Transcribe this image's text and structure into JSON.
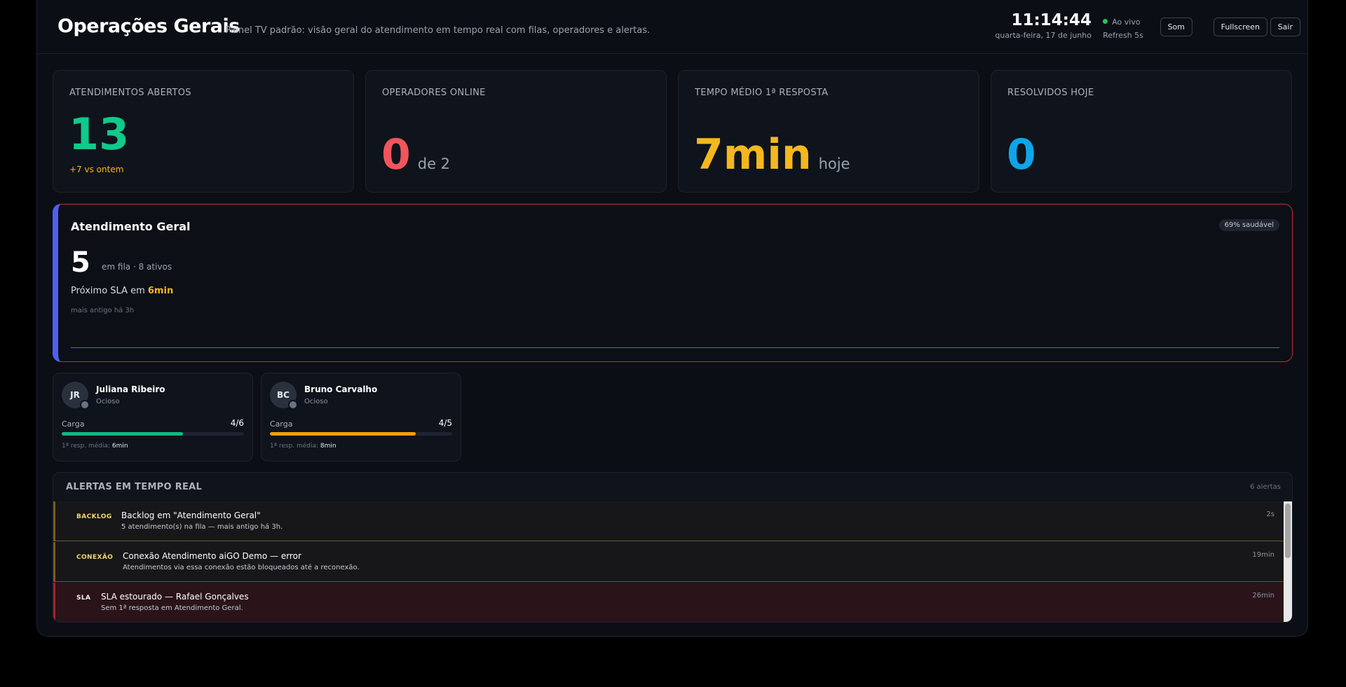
{
  "header": {
    "title": "Operações Gerais",
    "subtitle": "Painel TV padrão: visão geral do atendimento em tempo real com filas, operadores e alertas.",
    "time": "11:14:44",
    "date": "quarta-feira, 17 de junho",
    "live_label": "Ao vivo",
    "refresh_label": "Refresh 5s",
    "buttons": {
      "sound": "Som",
      "fullscreen": "Fullscreen",
      "exit": "Sair"
    }
  },
  "kpis": [
    {
      "label": "ATENDIMENTOS ABERTOS",
      "value": "13",
      "suffix": "",
      "sub": "+7 vs ontem",
      "color": "#10c98a"
    },
    {
      "label": "OPERADORES ONLINE",
      "value": "0",
      "suffix": "de 2",
      "sub": "",
      "color": "#f2545b"
    },
    {
      "label": "TEMPO MÉDIO 1ª RESPOSTA",
      "value": "7min",
      "suffix": "hoje",
      "sub": "",
      "color": "#f5b71f"
    },
    {
      "label": "RESOLVIDOS HOJE",
      "value": "0",
      "suffix": "",
      "sub": "",
      "color": "#0ea5e9"
    }
  ],
  "queue": {
    "name": "Atendimento Geral",
    "health": "69% saudável",
    "in_queue": "5",
    "summary": "em fila · 8 ativos",
    "sla_prefix": "Próximo SLA em ",
    "sla_value": "6min",
    "oldest": "mais antigo há 3h",
    "accent": "#4f5ff0"
  },
  "operators": [
    {
      "initials": "JR",
      "name": "Juliana Ribeiro",
      "state": "Ocioso",
      "load_label": "Carga",
      "load_text": "4/6",
      "load_fraction": 0.667,
      "load_color": "#10b981",
      "resp_label": "1ª resp. média: ",
      "resp_value": "6min"
    },
    {
      "initials": "BC",
      "name": "Bruno Carvalho",
      "state": "Ocioso",
      "load_label": "Carga",
      "load_text": "4/5",
      "load_fraction": 0.8,
      "load_color": "#f59e0b",
      "resp_label": "1ª resp. média: ",
      "resp_value": "8min"
    }
  ],
  "alerts": {
    "title": "ALERTAS EM TEMPO REAL",
    "count": "6 alertas",
    "items": [
      {
        "tag": "BACKLOG",
        "title": "Backlog em \"Atendimento Geral\"",
        "desc": "5 atendimento(s) na fila — mais antigo há 3h.",
        "ago": "2s",
        "tag_color": "#f5d76e",
        "bg": "#17171a",
        "border": "#7a5a1a"
      },
      {
        "tag": "CONEXÃO",
        "title": "Conexão Atendimento aiGO Demo — error",
        "desc": "Atendimentos via essa conexão estão bloqueados até a reconexão.",
        "ago": "19min",
        "tag_color": "#f5d76e",
        "bg": "#17171a",
        "border": "#7a5a1a"
      },
      {
        "tag": "SLA",
        "title": "SLA estourado — Rafael Gonçalves",
        "desc": "Sem 1ª resposta em Atendimento Geral.",
        "ago": "26min",
        "tag_color": "#f3f4f6",
        "bg": "#2a1419",
        "border": "#a3232e"
      }
    ]
  }
}
